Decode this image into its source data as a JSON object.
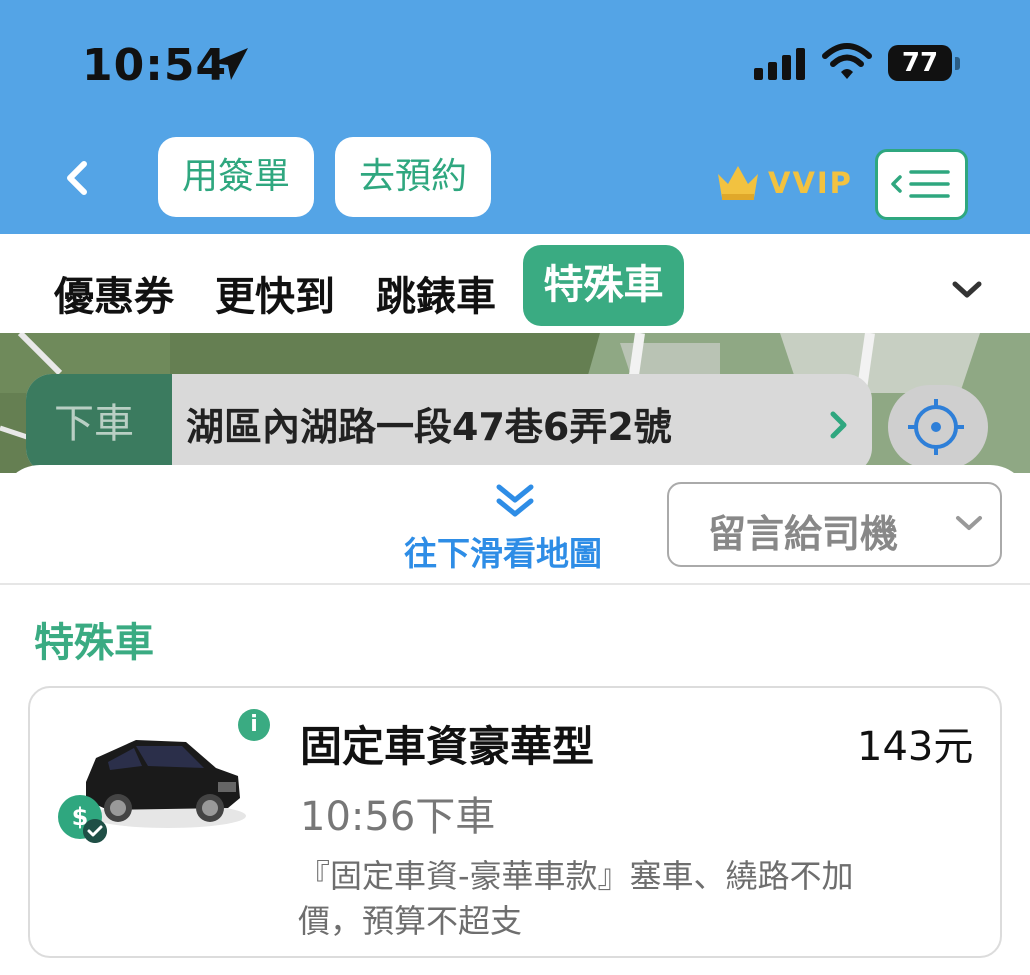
{
  "status_bar": {
    "time": "10:54",
    "battery": "77"
  },
  "header": {
    "pill_1": "用簽單",
    "pill_2": "去預約",
    "vvip": "VVIP"
  },
  "tabs": {
    "items": [
      "優惠券",
      "更快到",
      "跳錶車",
      "特殊車"
    ],
    "active": "特殊車"
  },
  "destination": {
    "label": "下車",
    "address": "湖區內湖路一段47巷6弄2號"
  },
  "sheet": {
    "scroll_hint": "往下滑看地圖",
    "message_button": "留言給司機",
    "section_title": "特殊車"
  },
  "car_option": {
    "name": "固定車資豪華型",
    "price": "143元",
    "eta": "10:56下車",
    "description": "『固定車資-豪華車款』塞車、繞路不加價，預算不超支",
    "badge": "$",
    "info": "i"
  },
  "colors": {
    "header_blue": "#54a4e6",
    "brand_green": "#3aab82",
    "link_blue": "#2e8de6",
    "gold": "#f2c240"
  }
}
